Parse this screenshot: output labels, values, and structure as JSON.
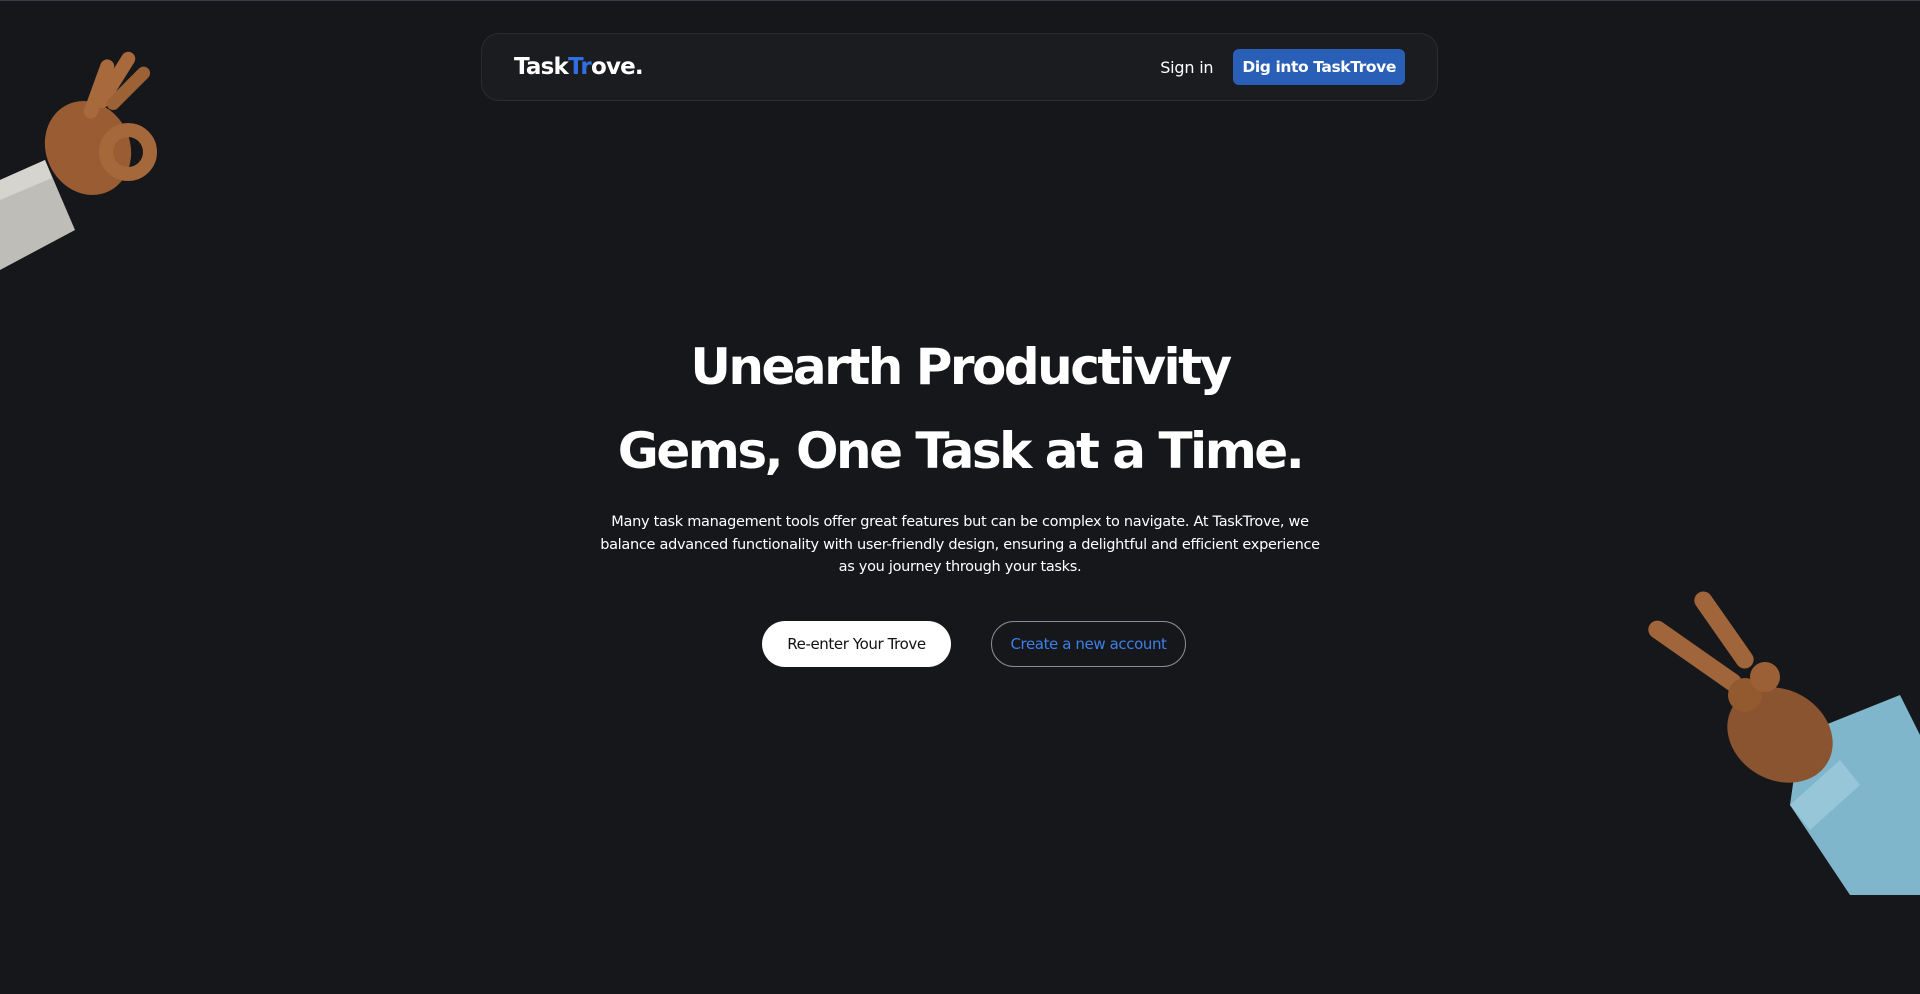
{
  "brand": {
    "name_part1": "Task",
    "name_accent": "Tr",
    "name_part2": "ove."
  },
  "nav": {
    "signin_label": "Sign in",
    "cta_label": "Dig into TaskTrove"
  },
  "hero": {
    "title_line1": "Unearth Productivity",
    "title_line2": "Gems, One Task at a Time.",
    "description": "Many task management tools offer great features but can be complex to navigate. At TaskTrove, we balance advanced functionality with user-friendly design, ensuring a delightful and efficient experience as you journey through your tasks.",
    "primary_button": "Re-enter Your Trove",
    "secondary_button": "Create a new account"
  },
  "decor": {
    "left_hand_icon": "ok-hand-icon",
    "right_hand_icon": "rock-hand-icon"
  },
  "colors": {
    "background": "#16171b",
    "accent_blue": "#2a5fb8",
    "link_blue": "#3d7fe8"
  }
}
